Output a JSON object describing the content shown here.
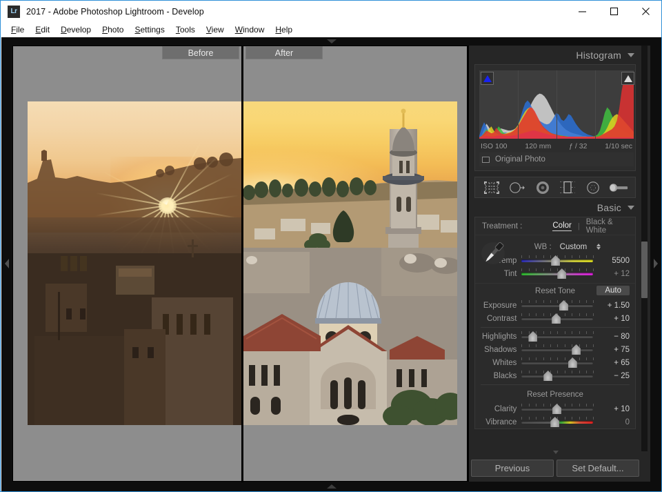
{
  "window": {
    "logo": "Lr",
    "title": "2017 - Adobe Photoshop Lightroom - Develop",
    "minimize": "minimize-icon",
    "maximize": "maximize-icon",
    "close": "close-icon"
  },
  "menubar": {
    "items": [
      {
        "label": "File",
        "mnemonic": "F",
        "rest": "ile"
      },
      {
        "label": "Edit",
        "mnemonic": "E",
        "rest": "dit"
      },
      {
        "label": "Develop",
        "mnemonic": "D",
        "rest": "evelop"
      },
      {
        "label": "Photo",
        "mnemonic": "P",
        "rest": "hoto"
      },
      {
        "label": "Settings",
        "mnemonic": "S",
        "rest": "ettings"
      },
      {
        "label": "Tools",
        "mnemonic": "T",
        "rest": "ools"
      },
      {
        "label": "View",
        "mnemonic": "V",
        "rest": "iew"
      },
      {
        "label": "Window",
        "mnemonic": "W",
        "rest": "indow"
      },
      {
        "label": "Help",
        "mnemonic": "H",
        "rest": "elp"
      }
    ]
  },
  "stage": {
    "before_label": "Before",
    "after_label": "After"
  },
  "histogram": {
    "title": "Histogram",
    "shadow_clip": "shadow-clipping-indicator",
    "highlight_clip": "highlight-clipping-indicator",
    "exif": {
      "iso": "ISO 100",
      "focal": "120 mm",
      "aperture": "ƒ / 32",
      "shutter": "1/10 sec"
    },
    "original_photo": "Original Photo"
  },
  "tools": [
    {
      "name": "crop-overlay-tool",
      "title": "Crop Overlay"
    },
    {
      "name": "spot-removal-tool",
      "title": "Spot Removal"
    },
    {
      "name": "red-eye-correction-tool",
      "title": "Red Eye Correction"
    },
    {
      "name": "graduated-filter-tool",
      "title": "Graduated Filter"
    },
    {
      "name": "radial-filter-tool",
      "title": "Radial Filter"
    },
    {
      "name": "adjustment-brush-tool",
      "title": "Adjustment Brush"
    }
  ],
  "basic": {
    "title": "Basic",
    "treatment_label": "Treatment :",
    "treatment_options": [
      "Color",
      "Black & White"
    ],
    "treatment_selected": "Color",
    "wb_label": "WB :",
    "wb_value": "Custom",
    "wb_sliders": [
      {
        "name": "Temp",
        "value": "5500",
        "pos": 47,
        "grad": "grad-temp",
        "dim": false
      },
      {
        "name": "Tint",
        "value": "+ 12",
        "pos": 57,
        "grad": "grad-tint",
        "dim": true
      }
    ],
    "tone_header": "Reset Tone",
    "auto_label": "Auto",
    "tone_sliders_a": [
      {
        "name": "Exposure",
        "value": "+ 1.50",
        "pos": 60,
        "dim": false
      },
      {
        "name": "Contrast",
        "value": "+ 10",
        "pos": 48,
        "dim": false
      }
    ],
    "tone_sliders_b": [
      {
        "name": "Highlights",
        "value": "− 80",
        "pos": 11,
        "dim": false
      },
      {
        "name": "Shadows",
        "value": "+ 75",
        "pos": 80,
        "dim": false
      },
      {
        "name": "Whites",
        "value": "+ 65",
        "pos": 74,
        "dim": false
      },
      {
        "name": "Blacks",
        "value": "− 25",
        "pos": 35,
        "dim": false
      }
    ],
    "presence_header": "Reset Presence",
    "presence_sliders": [
      {
        "name": "Clarity",
        "value": "+ 10",
        "pos": 49,
        "grad": "",
        "dim": false
      },
      {
        "name": "Vibrance",
        "value": "0",
        "pos": 46,
        "grad": "grad-vib",
        "dim": true
      }
    ]
  },
  "footer": {
    "previous": "Previous",
    "set_default": "Set Default..."
  },
  "colors": {
    "panel_bg": "#262626",
    "accent_blue": "#2f8fd8",
    "stage_bg": "#8d8d8d"
  },
  "chart_data": {
    "type": "area",
    "title": "Histogram",
    "xlabel": "",
    "ylabel": "",
    "xlim": [
      0,
      255
    ],
    "ylim": [
      0,
      100
    ],
    "grid": true,
    "legend": "none",
    "series": [
      {
        "name": "luminance",
        "color": "#c8c8c8",
        "values": [
          2,
          5,
          14,
          22,
          17,
          10,
          8,
          9,
          12,
          15,
          14,
          13,
          12,
          12,
          13,
          15,
          18,
          22,
          27,
          33,
          40,
          47,
          54,
          60,
          64,
          66,
          65,
          62,
          57,
          50,
          43,
          36,
          30,
          25,
          20,
          16,
          13,
          11,
          9,
          8,
          7,
          6,
          5,
          4,
          4,
          3,
          3,
          3,
          3,
          3,
          3,
          2,
          2,
          2,
          2,
          2,
          2,
          2,
          2,
          2,
          2,
          2,
          2,
          2,
          2
        ]
      },
      {
        "name": "blue",
        "color": "#2a6fd4",
        "values": [
          4,
          16,
          24,
          18,
          9,
          5,
          4,
          4,
          5,
          7,
          9,
          9,
          8,
          9,
          11,
          14,
          20,
          30,
          42,
          52,
          56,
          52,
          44,
          36,
          30,
          26,
          24,
          22,
          21,
          22,
          26,
          32,
          38,
          35,
          28,
          26,
          30,
          36,
          34,
          28,
          22,
          17,
          13,
          10,
          8,
          6,
          5,
          4,
          3,
          3,
          2,
          2,
          2,
          2,
          2,
          2,
          2,
          2,
          2,
          2,
          2,
          2,
          2,
          2,
          2
        ]
      },
      {
        "name": "green",
        "color": "#3fbf3f",
        "values": [
          2,
          4,
          9,
          14,
          11,
          8,
          7,
          12,
          18,
          14,
          9,
          7,
          7,
          8,
          9,
          11,
          14,
          18,
          24,
          30,
          36,
          40,
          40,
          36,
          30,
          24,
          19,
          15,
          12,
          10,
          8,
          7,
          6,
          5,
          5,
          4,
          4,
          3,
          3,
          3,
          3,
          3,
          3,
          3,
          3,
          3,
          3,
          3,
          4,
          6,
          12,
          24,
          38,
          46,
          42,
          34,
          26,
          20,
          16,
          13,
          11,
          9,
          7,
          5,
          3
        ]
      },
      {
        "name": "red",
        "color": "#e03030",
        "values": [
          2,
          4,
          8,
          12,
          10,
          8,
          9,
          16,
          12,
          8,
          7,
          7,
          8,
          9,
          11,
          14,
          18,
          24,
          30,
          36,
          42,
          46,
          45,
          40,
          33,
          26,
          20,
          16,
          13,
          10,
          8,
          7,
          6,
          5,
          4,
          4,
          3,
          3,
          3,
          3,
          3,
          3,
          3,
          3,
          3,
          3,
          3,
          3,
          3,
          3,
          4,
          6,
          8,
          10,
          12,
          14,
          18,
          26,
          44,
          70,
          88,
          96,
          98,
          96,
          90
        ]
      },
      {
        "name": "magenta",
        "color": "#d83ad8",
        "values": [
          1,
          2,
          3,
          4,
          3,
          3,
          3,
          4,
          5,
          5,
          4,
          4,
          4,
          4,
          5,
          5,
          6,
          7,
          8,
          9,
          10,
          11,
          12,
          12,
          11,
          10,
          9,
          8,
          7,
          6,
          5,
          5,
          4,
          4,
          3,
          3,
          3,
          3,
          3,
          3,
          2,
          2,
          2,
          2,
          2,
          2,
          2,
          2,
          2,
          2,
          2,
          2,
          2,
          2,
          2,
          2,
          2,
          2,
          2,
          2,
          2,
          2,
          2,
          2,
          2
        ]
      },
      {
        "name": "yellow",
        "color": "#e0d020",
        "values": [
          2,
          3,
          5,
          8,
          14,
          18,
          12,
          8,
          6,
          6,
          7,
          8,
          9,
          10,
          12,
          15,
          20,
          27,
          34,
          40,
          44,
          46,
          44,
          38,
          31,
          24,
          18,
          14,
          11,
          9,
          7,
          6,
          5,
          4,
          4,
          3,
          3,
          3,
          3,
          3,
          3,
          3,
          3,
          3,
          3,
          3,
          3,
          3,
          3,
          3,
          4,
          6,
          10,
          16,
          24,
          30,
          34,
          36,
          34,
          30,
          26,
          22,
          18,
          14,
          10
        ]
      }
    ]
  }
}
